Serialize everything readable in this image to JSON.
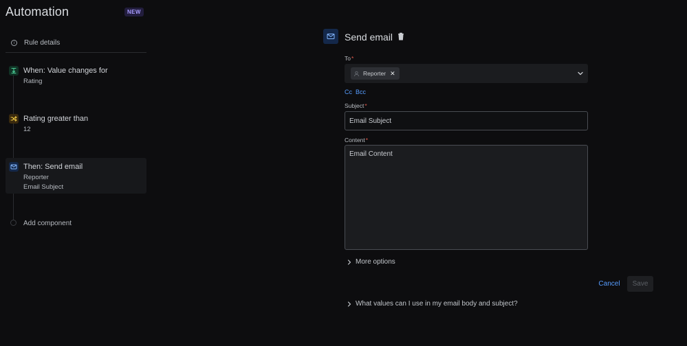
{
  "header": {
    "title": "Automation",
    "badge": "NEW"
  },
  "sidebar": {
    "rule_details": {
      "label": "Rule details",
      "icon": "info-icon"
    },
    "steps": [
      {
        "title": "When: Value changes for",
        "lines": [
          "Rating"
        ],
        "icon": "trigger-icon",
        "color": "#22a06b"
      },
      {
        "title": "Rating greater than",
        "lines": [
          "12"
        ],
        "icon": "shuffle-icon",
        "color": "#e2b203"
      },
      {
        "title": "Then: Send email",
        "lines": [
          "Reporter",
          "Email Subject"
        ],
        "icon": "mail-icon",
        "color": "#579dff",
        "active": true
      }
    ],
    "add_component": "Add component"
  },
  "panel": {
    "title": "Send email",
    "icon": "mail-icon",
    "to": {
      "label": "To",
      "required_mark": "*",
      "chip": "Reporter"
    },
    "cc_label": "Cc",
    "bcc_label": "Bcc",
    "subject": {
      "label": "Subject",
      "required_mark": "*",
      "value": "Email Subject"
    },
    "content": {
      "label": "Content",
      "required_mark": "*",
      "value": "Email Content"
    },
    "more_options": "More options",
    "cancel_label": "Cancel",
    "save_label": "Save",
    "help_link": "What values can I use in my email body and subject?"
  },
  "colors": {
    "background": "#0d0d0f",
    "accent": "#579dff",
    "required": "#e2584a"
  }
}
